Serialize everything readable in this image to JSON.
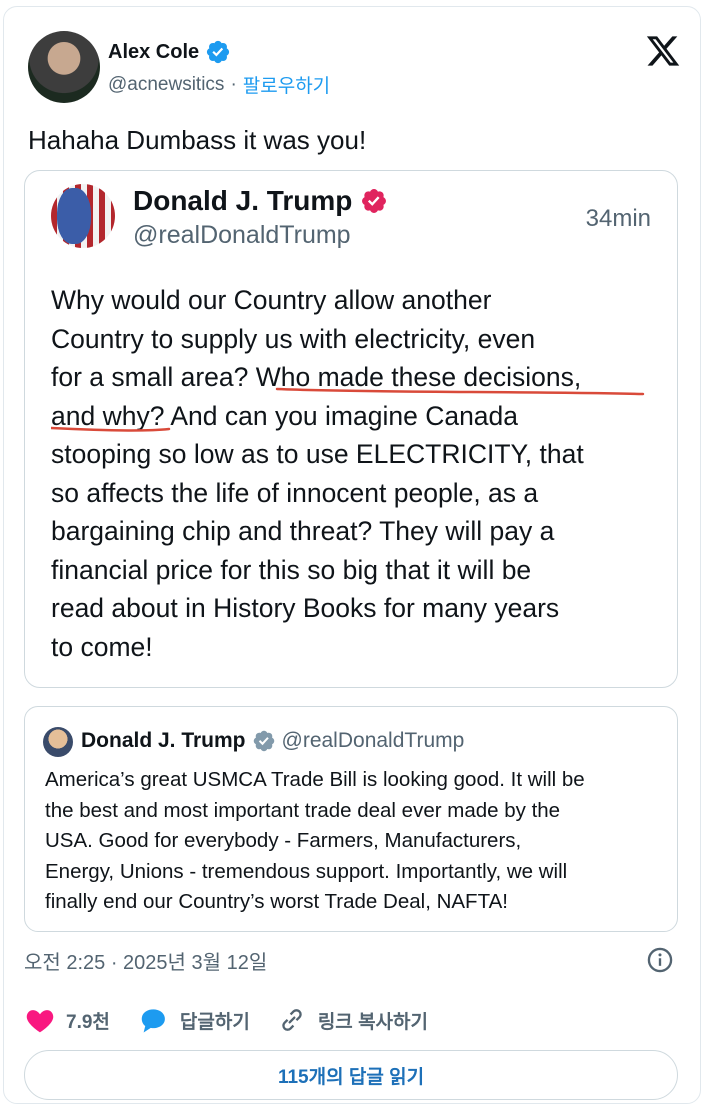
{
  "tweet": {
    "author_name": "Alex Cole",
    "author_handle": "@acnewsitics",
    "separator": "·",
    "follow_label": "팔로우하기",
    "text": "Hahaha Dumbass it was you!"
  },
  "quote1": {
    "name": "Donald J. Trump",
    "handle": "@realDonaldTrump",
    "time": "34min",
    "lines": [
      "Why would our Country allow another",
      "Country to supply us with electricity, even",
      "for a small area? Who made these decisions,",
      "and why? And can you imagine Canada",
      "stooping so low as to use ELECTRICITY, that",
      "so affects the life of innocent people, as a",
      "bargaining chip and threat? They will pay a",
      "financial price for this so big that it will be",
      "read about in History Books for many years",
      "to come!"
    ]
  },
  "quote2": {
    "name": "Donald J. Trump",
    "handle": "@realDonaldTrump",
    "lines": [
      "America’s great USMCA Trade Bill is looking good. It will be",
      "the best and most important trade deal ever made by the",
      "USA. Good for everybody - Farmers, Manufacturers,",
      "Energy, Unions - tremendous support. Importantly, we will",
      "finally end our Country’s worst Trade Deal, NAFTA!"
    ]
  },
  "meta": {
    "timestamp": "오전 2:25 · 2025년 3월 12일"
  },
  "actions": {
    "likes": "7.9천",
    "reply_label": "답글하기",
    "copy_link_label": "링크 복사하기"
  },
  "read_replies_label": "115개의 답글 읽기",
  "colors": {
    "accent_blue": "#1d9bf0",
    "like_pink": "#f91880",
    "verified_blue": "#1d9bf0",
    "verified_red": "#e0245e"
  },
  "icons": [
    "verified-badge-icon",
    "x-logo-icon",
    "info-icon",
    "heart-icon",
    "reply-bubble-icon",
    "link-icon"
  ]
}
